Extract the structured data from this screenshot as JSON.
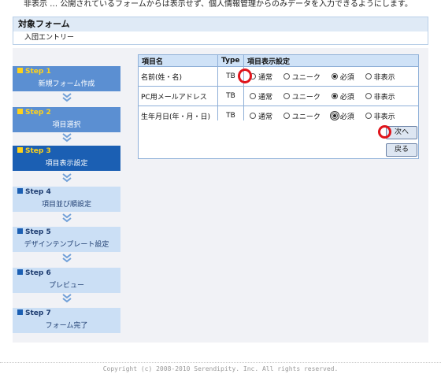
{
  "top_note": "非表示 … 公開されているフォームからは表示せず、個人情報管理からのみデータを入力できるようにします。",
  "section": {
    "title": "対象フォーム",
    "form_name": "入団エントリー"
  },
  "steps": [
    {
      "label": "Step 1",
      "name": "新規フォーム作成",
      "state": "done"
    },
    {
      "label": "Step 2",
      "name": "項目選択",
      "state": "done"
    },
    {
      "label": "Step 3",
      "name": "項目表示設定",
      "state": "current"
    },
    {
      "label": "Step 4",
      "name": "項目並び順設定",
      "state": "pending"
    },
    {
      "label": "Step 5",
      "name": "デザインテンプレート設定",
      "state": "pending"
    },
    {
      "label": "Step 6",
      "name": "プレビュー",
      "state": "pending"
    },
    {
      "label": "Step 7",
      "name": "フォーム完了",
      "state": "pending"
    }
  ],
  "table": {
    "headers": {
      "item": "項目名",
      "type": "Type",
      "setting": "項目表示設定"
    },
    "options": [
      "通常",
      "ユニーク",
      "必須",
      "非表示"
    ],
    "rows": [
      {
        "name": "名前(姓・名)",
        "type": "TB",
        "selected": "必須"
      },
      {
        "name": "PC用メールアドレス",
        "type": "TB",
        "selected": "必須"
      },
      {
        "name": "生年月日(年・月・日)",
        "type": "TB",
        "selected": "必須"
      }
    ]
  },
  "buttons": {
    "next": "次へ",
    "back": "戻る"
  },
  "footer": "Copyright (c) 2008-2010 Serendipity. Inc. All rights reserved.",
  "colors": {
    "marker": "#e0141b",
    "step_current": "#1b5fb3",
    "step_done": "#5b8fd2",
    "step_pending": "#cbdff5"
  }
}
